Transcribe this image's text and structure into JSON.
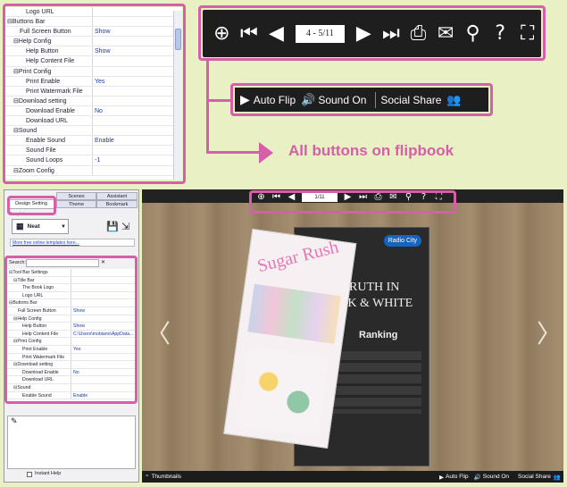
{
  "top_grid": {
    "rows": [
      {
        "k": "Logo URL",
        "v": "",
        "indent": 3
      },
      {
        "k": "⊟Buttons Bar",
        "v": "",
        "indent": 0
      },
      {
        "k": "Full Screen Button",
        "v": "Show",
        "indent": 2
      },
      {
        "k": "⊟Help Config",
        "v": "",
        "indent": 1
      },
      {
        "k": "Help Button",
        "v": "Show",
        "indent": 3
      },
      {
        "k": "Help Content File",
        "v": "",
        "indent": 3
      },
      {
        "k": "⊟Print Config",
        "v": "",
        "indent": 1
      },
      {
        "k": "Print Enable",
        "v": "Yes",
        "indent": 3
      },
      {
        "k": "Print Watermark File",
        "v": "",
        "indent": 3
      },
      {
        "k": "⊟Download setting",
        "v": "",
        "indent": 1
      },
      {
        "k": "Download Enable",
        "v": "No",
        "indent": 3
      },
      {
        "k": "Download URL",
        "v": "",
        "indent": 3
      },
      {
        "k": "⊟Sound",
        "v": "",
        "indent": 1
      },
      {
        "k": "Enable Sound",
        "v": "Enable",
        "indent": 3
      },
      {
        "k": "Sound File",
        "v": "",
        "indent": 3
      },
      {
        "k": "Sound Loops",
        "v": "-1",
        "indent": 3
      },
      {
        "k": "⊟Zoom Config",
        "v": "",
        "indent": 1
      }
    ]
  },
  "big_toolbar": {
    "page": "4 - 5/11",
    "icons": [
      "zoom-in-icon",
      "first-page-icon",
      "prev-page-icon",
      "next-page-icon",
      "last-page-icon",
      "print-icon",
      "email-icon",
      "search-icon",
      "help-icon",
      "fullscreen-icon"
    ]
  },
  "bar2": {
    "autoflip": "Auto Flip",
    "sound": "Sound On",
    "share": "Social Share"
  },
  "callout": "All buttons on flipbook",
  "left": {
    "tabs": [
      "Scenes",
      "Assistant",
      "Design Setting",
      "Theme",
      "Bookmark"
    ],
    "template_label": "Template",
    "template_name": "Neat",
    "more_link": "More free online templates here...",
    "search_label": "Search:",
    "instant_help": "Instant Help",
    "rows": [
      {
        "k": "⊟Tool Bar Settings",
        "v": "",
        "indent": 0
      },
      {
        "k": "⊟Title Bar",
        "v": "",
        "indent": 1
      },
      {
        "k": "The Book Logo",
        "v": "",
        "indent": 3
      },
      {
        "k": "Logo URL",
        "v": "",
        "indent": 3
      },
      {
        "k": "⊟Buttons Bar",
        "v": "",
        "indent": 0
      },
      {
        "k": "Full Screen Button",
        "v": "Show",
        "indent": 2
      },
      {
        "k": "⊟Help Config",
        "v": "",
        "indent": 1
      },
      {
        "k": "Help Button",
        "v": "Show",
        "indent": 3
      },
      {
        "k": "Help Content File",
        "v": "C:\\Users\\mobiano\\AppData...",
        "indent": 3
      },
      {
        "k": "⊟Print Config",
        "v": "",
        "indent": 1
      },
      {
        "k": "Print Enable",
        "v": "Yes",
        "indent": 3
      },
      {
        "k": "Print Watermark File",
        "v": "",
        "indent": 3
      },
      {
        "k": "⊟Download setting",
        "v": "",
        "indent": 1
      },
      {
        "k": "Download Enable",
        "v": "No",
        "indent": 3
      },
      {
        "k": "Download URL",
        "v": "",
        "indent": 3
      },
      {
        "k": "⊟Sound",
        "v": "",
        "indent": 1
      },
      {
        "k": "Enable Sound",
        "v": "Enable",
        "indent": 3
      }
    ]
  },
  "viewer": {
    "page": "1/11",
    "thumbnails": "Thumbnails",
    "autoflip": "Auto Flip",
    "sound": "Sound On",
    "share": "Social Share",
    "magazine": "Sugar Rush",
    "page_title": "THE TRUTH IN BLACK & WHITE",
    "ranking": "Ranking",
    "radio": "Radio City"
  }
}
